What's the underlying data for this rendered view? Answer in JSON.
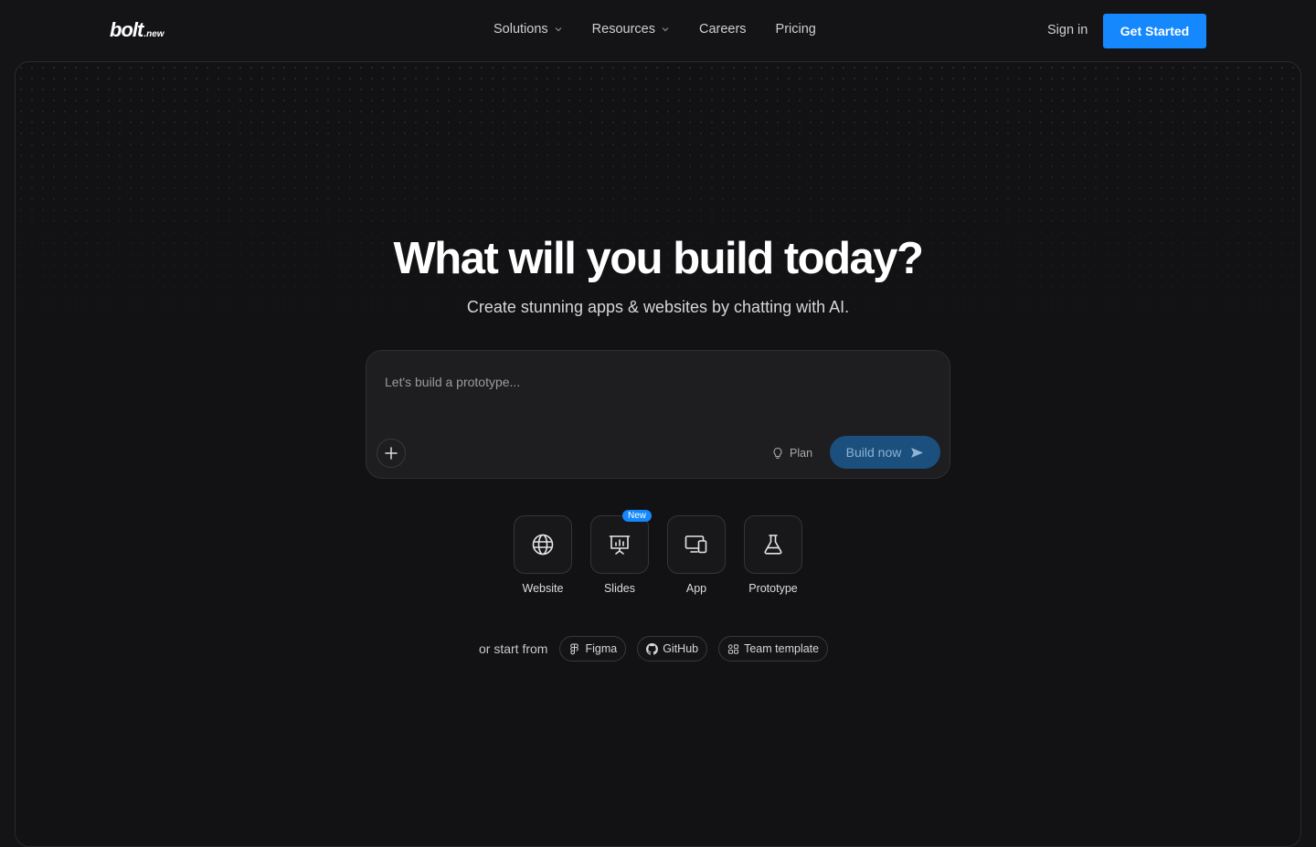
{
  "header": {
    "logo_main": "bolt",
    "logo_sub": ".new",
    "nav": [
      {
        "label": "Solutions",
        "has_dropdown": true
      },
      {
        "label": "Resources",
        "has_dropdown": true
      },
      {
        "label": "Careers",
        "has_dropdown": false
      },
      {
        "label": "Pricing",
        "has_dropdown": false
      }
    ],
    "sign_in": "Sign in",
    "get_started": "Get Started"
  },
  "hero": {
    "title": "What will you build today?",
    "subtitle": "Create stunning apps & websites by chatting with AI."
  },
  "prompt": {
    "placeholder": "Let's build a prototype...",
    "value": "",
    "plan_label": "Plan",
    "build_label": "Build now"
  },
  "categories": [
    {
      "label": "Website",
      "icon": "globe-icon",
      "badge": ""
    },
    {
      "label": "Slides",
      "icon": "presentation-chart-icon",
      "badge": "New"
    },
    {
      "label": "App",
      "icon": "devices-icon",
      "badge": ""
    },
    {
      "label": "Prototype",
      "icon": "flask-icon",
      "badge": ""
    }
  ],
  "start_from": {
    "label": "or start from",
    "options": [
      {
        "label": "Figma",
        "icon": "figma-icon"
      },
      {
        "label": "GitHub",
        "icon": "github-icon"
      },
      {
        "label": "Team template",
        "icon": "team-template-icon"
      }
    ]
  },
  "colors": {
    "background": "#141416",
    "accent": "#1488fc",
    "build_button": "#1b4f7d"
  }
}
